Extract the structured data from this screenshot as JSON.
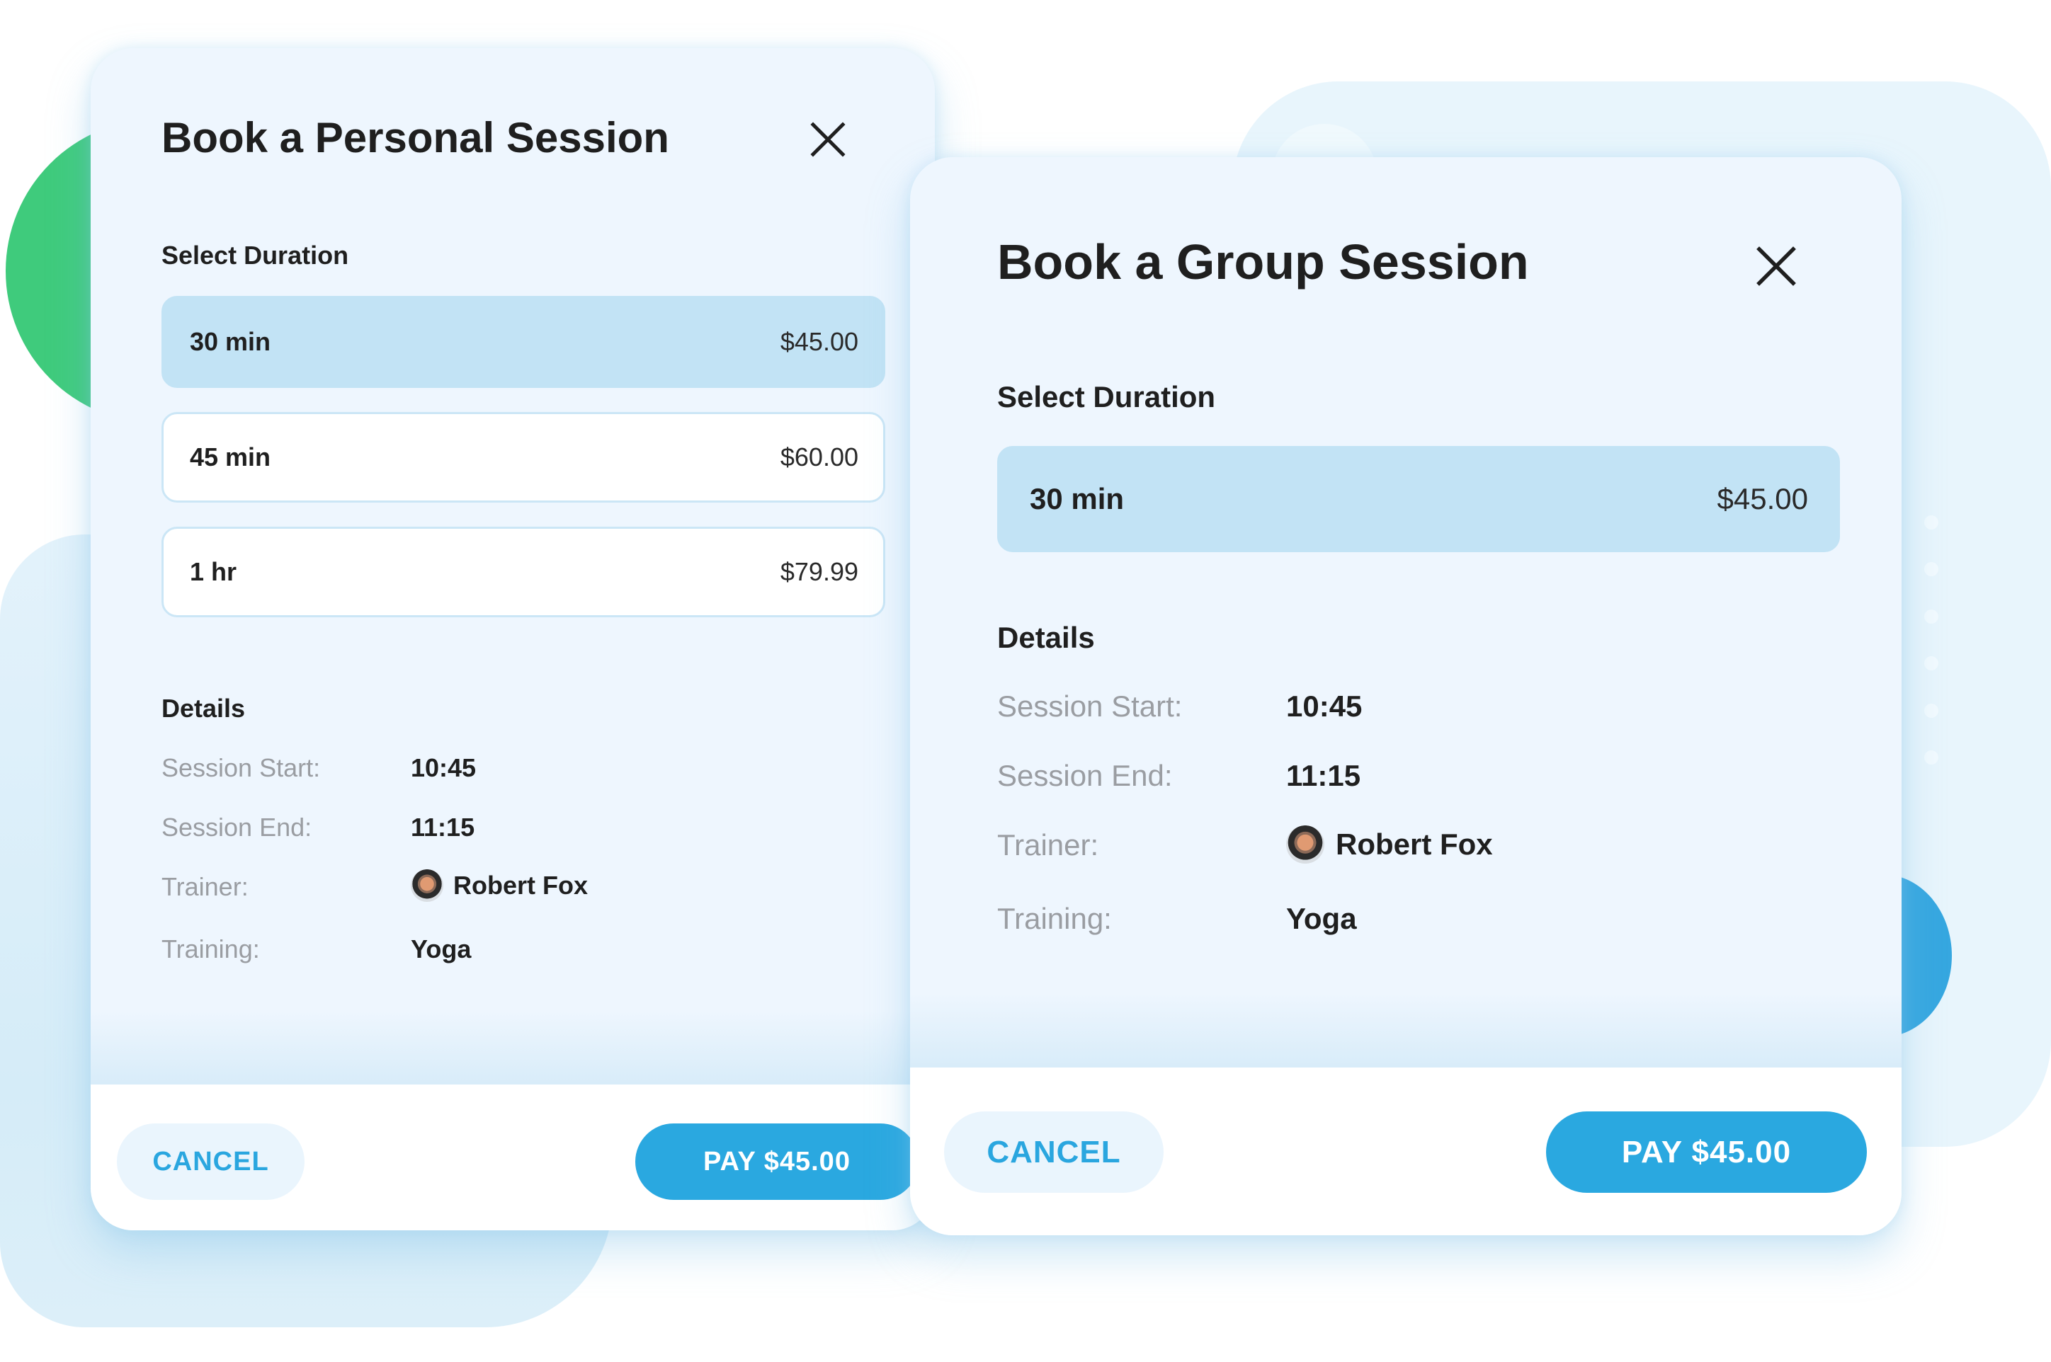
{
  "colors": {
    "accent": "#2AA8E0",
    "selected_option_bg": "#C2E3F5",
    "card_bg": "#EEF6FE",
    "decor_green": "#3FCB7C",
    "decor_blue": "#36A7E0",
    "label_gray": "#9A9DA2",
    "text_dark": "#1F1F1F"
  },
  "personal_dialog": {
    "title": "Book a Personal Session",
    "close_icon": "close-icon",
    "duration_label": "Select Duration",
    "options": [
      {
        "label": "30 min",
        "price": "$45.00",
        "selected": true
      },
      {
        "label": "45 min",
        "price": "$60.00",
        "selected": false
      },
      {
        "label": "1 hr",
        "price": "$79.99",
        "selected": false
      }
    ],
    "details_label": "Details",
    "details": [
      {
        "key": "Session Start:",
        "value": "10:45"
      },
      {
        "key": "Session End:",
        "value": "11:15"
      },
      {
        "key": "Trainer:",
        "value": "Robert Fox",
        "avatar": true
      },
      {
        "key": "Training:",
        "value": "Yoga"
      }
    ],
    "cancel_label": "CANCEL",
    "pay_label": "PAY $45.00"
  },
  "group_dialog": {
    "title": "Book a Group Session",
    "close_icon": "close-icon",
    "duration_label": "Select Duration",
    "options": [
      {
        "label": "30 min",
        "price": "$45.00",
        "selected": true
      }
    ],
    "details_label": "Details",
    "details": [
      {
        "key": "Session Start:",
        "value": "10:45"
      },
      {
        "key": "Session End:",
        "value": "11:15"
      },
      {
        "key": "Trainer:",
        "value": "Robert Fox",
        "avatar": true
      },
      {
        "key": "Training:",
        "value": "Yoga"
      }
    ],
    "cancel_label": "CANCEL",
    "pay_label": "PAY $45.00"
  }
}
